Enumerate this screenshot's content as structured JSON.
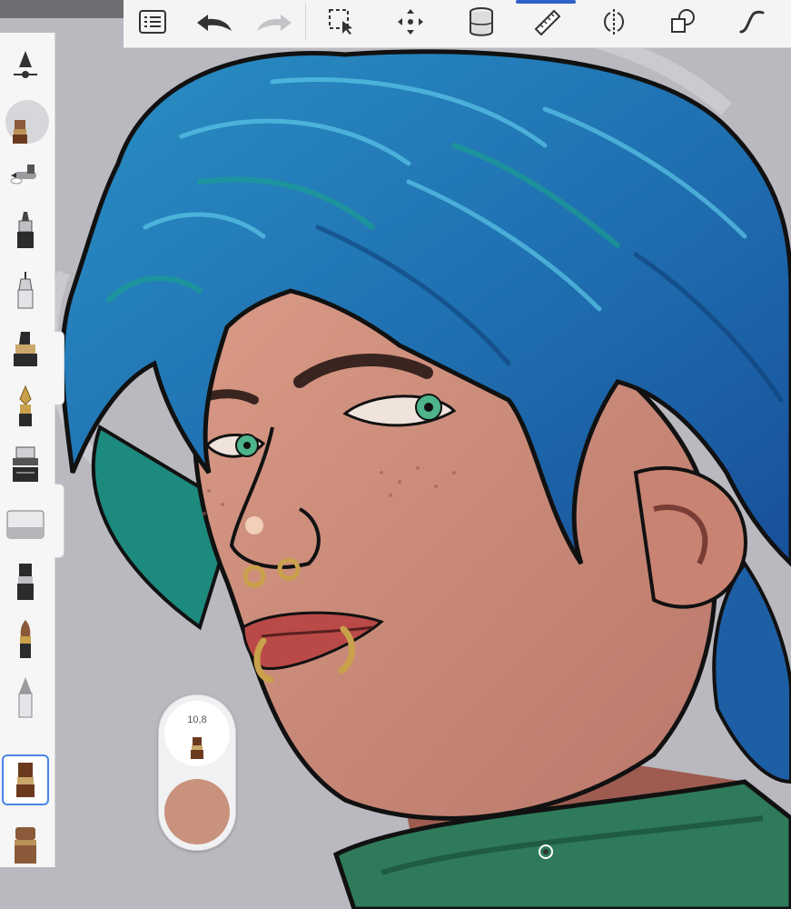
{
  "toolbar": {
    "items": [
      {
        "name": "brush-library",
        "icon": "list-icon"
      },
      {
        "name": "undo",
        "icon": "undo-arrow-icon"
      },
      {
        "name": "redo",
        "icon": "redo-arrow-icon"
      },
      {
        "name": "selection",
        "icon": "selection-icon"
      },
      {
        "name": "transform",
        "icon": "move-icon"
      },
      {
        "name": "layers",
        "icon": "layers-cylinder-icon"
      },
      {
        "name": "ruler",
        "icon": "ruler-icon"
      },
      {
        "name": "symmetry",
        "icon": "symmetry-icon"
      },
      {
        "name": "shapes",
        "icon": "shapes-icon"
      },
      {
        "name": "curves",
        "icon": "curve-icon"
      }
    ],
    "active_tool": "ruler",
    "accent_color": "#2f5fc9"
  },
  "sidebar": {
    "tools": [
      {
        "name": "brush-properties",
        "icon": "cone-slider-icon"
      },
      {
        "name": "current-brush",
        "icon": "paint-brush-icon"
      },
      {
        "name": "airbrush",
        "icon": "airbrush-icon"
      },
      {
        "name": "marker",
        "icon": "marker-icon"
      },
      {
        "name": "technical-pen",
        "icon": "technical-pen-icon"
      },
      {
        "name": "chisel-marker",
        "icon": "chisel-marker-icon"
      },
      {
        "name": "fountain-pen",
        "icon": "fountain-pen-icon"
      },
      {
        "name": "stamp-brush",
        "icon": "stamp-brush-icon"
      },
      {
        "name": "eraser",
        "icon": "eraser-icon"
      },
      {
        "name": "flat-brush",
        "icon": "flat-brush-icon"
      },
      {
        "name": "round-brush",
        "icon": "round-brush-icon"
      },
      {
        "name": "pencil",
        "icon": "pencil-icon"
      },
      {
        "name": "paint-brush-selected",
        "icon": "paint-brush-icon"
      },
      {
        "name": "wide-brush",
        "icon": "wide-brush-icon"
      }
    ],
    "selected_index": 12,
    "selection_color": "#4a86e8"
  },
  "brush_puck": {
    "size_value": "10,8",
    "color": "#c9927c",
    "brush_icon": "paint-brush-icon"
  },
  "canvas": {
    "background_color": "#b9b9bf",
    "handle_icon": "canvas-rotate-handle-icon"
  }
}
